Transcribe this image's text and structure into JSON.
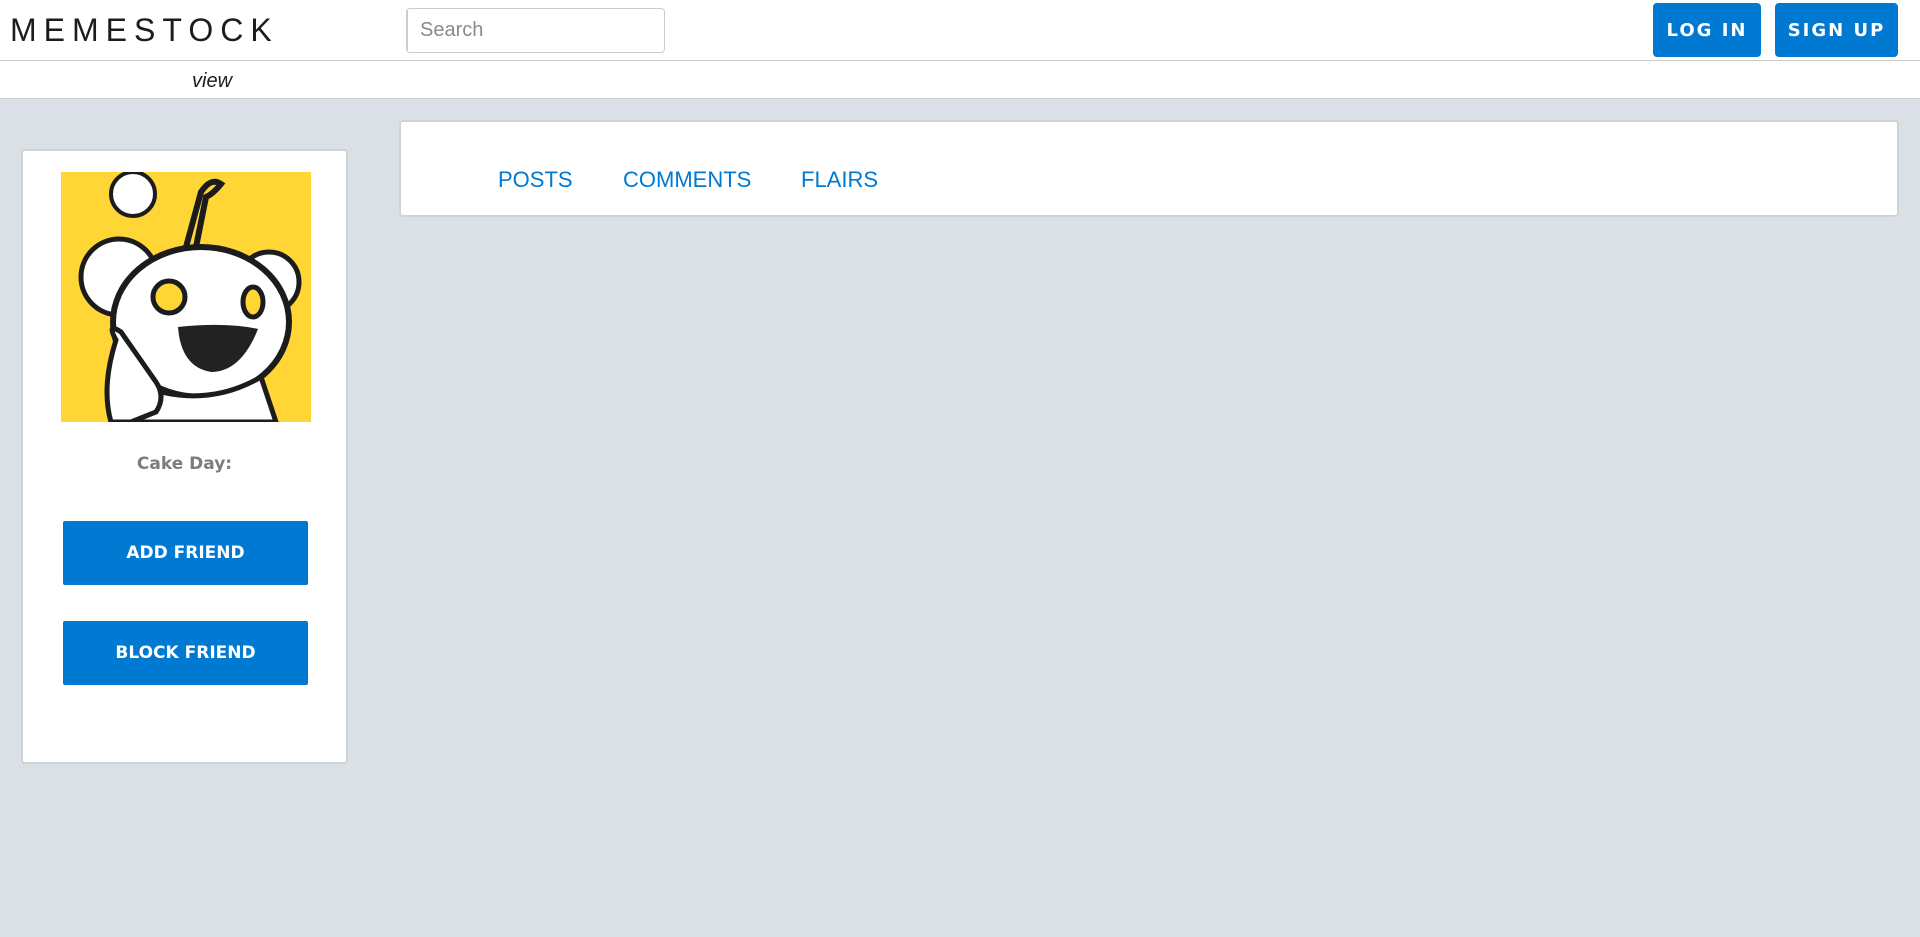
{
  "header": {
    "logo": "MEMESTOCK",
    "search": {
      "placeholder": "Search",
      "value": ""
    },
    "login_label": "LOG IN",
    "signup_label": "SIGN UP"
  },
  "subheader": {
    "view_label": "view"
  },
  "profile": {
    "avatar_icon": "snoo-avatar-icon",
    "cake_day_label": "Cake Day:",
    "add_friend_label": "ADD FRIEND",
    "block_friend_label": "BLOCK FRIEND"
  },
  "tabs": [
    {
      "label": "POSTS"
    },
    {
      "label": "COMMENTS"
    },
    {
      "label": "FLAIRS"
    }
  ],
  "colors": {
    "accent": "#0079d3",
    "background": "#dae0e6",
    "avatar_bg": "#ffd635"
  }
}
